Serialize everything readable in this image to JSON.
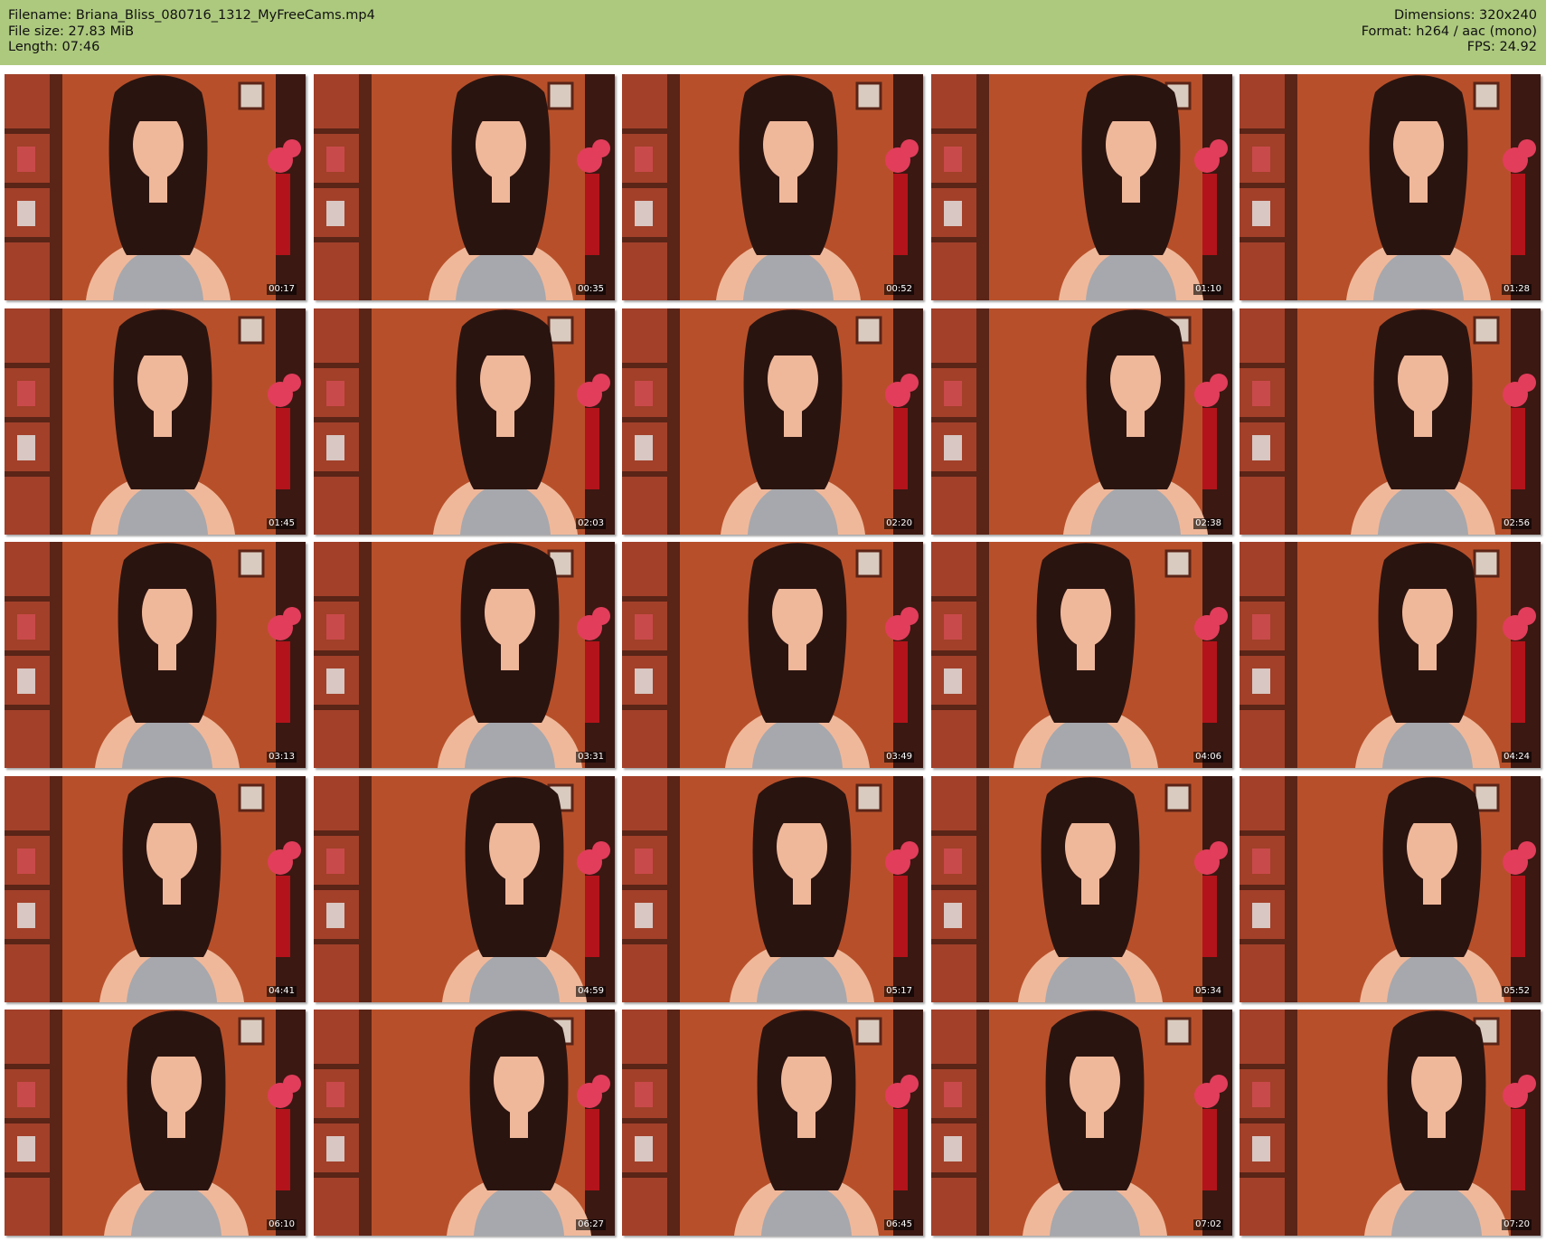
{
  "header": {
    "filename_label": "Filename: Briana_Bliss_080716_1312_MyFreeCams.mp4",
    "filesize_label": "File size: 27.83 MiB",
    "length_label": "Length: 07:46",
    "dimensions_label": "Dimensions: 320x240",
    "format_label": "Format: h264 / aac (mono)",
    "fps_label": "FPS: 24.92"
  },
  "colors": {
    "header_bg": "#adc97e",
    "thumb_bg": "#b7502a",
    "shelf": "#5a2417",
    "hair": "#2a1410",
    "skin": "#f0b89a",
    "top": "#a6a8ad",
    "flowers": "#e23d5b"
  },
  "thumbnails": [
    {
      "timestamp": "00:17"
    },
    {
      "timestamp": "00:35"
    },
    {
      "timestamp": "00:52"
    },
    {
      "timestamp": "01:10"
    },
    {
      "timestamp": "01:28"
    },
    {
      "timestamp": "01:45"
    },
    {
      "timestamp": "02:03"
    },
    {
      "timestamp": "02:20"
    },
    {
      "timestamp": "02:38"
    },
    {
      "timestamp": "02:56"
    },
    {
      "timestamp": "03:13"
    },
    {
      "timestamp": "03:31"
    },
    {
      "timestamp": "03:49"
    },
    {
      "timestamp": "04:06"
    },
    {
      "timestamp": "04:24"
    },
    {
      "timestamp": "04:41"
    },
    {
      "timestamp": "04:59"
    },
    {
      "timestamp": "05:17"
    },
    {
      "timestamp": "05:34"
    },
    {
      "timestamp": "05:52"
    },
    {
      "timestamp": "06:10"
    },
    {
      "timestamp": "06:27"
    },
    {
      "timestamp": "06:45"
    },
    {
      "timestamp": "07:02"
    },
    {
      "timestamp": "07:20"
    }
  ]
}
